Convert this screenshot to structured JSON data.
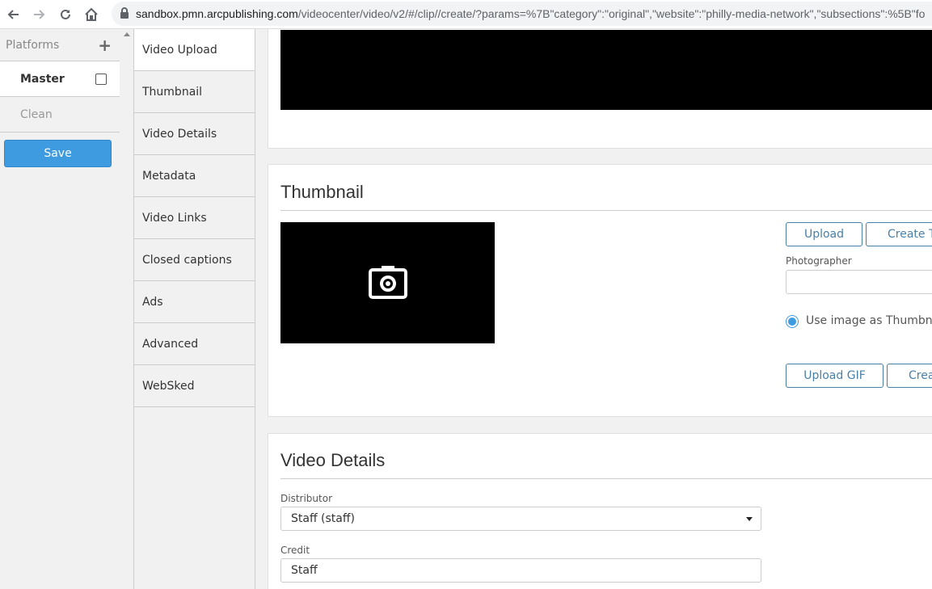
{
  "browser": {
    "url_host": "sandbox.pmn.arcpublishing.com",
    "url_path": "/videocenter/video/v2/#/clip//create/?params=%7B\"category\":\"original\",\"website\":\"philly-media-network\",\"subsections\":%5B\"fo"
  },
  "platforms": {
    "title": "Platforms",
    "items": [
      {
        "label": "Master"
      },
      {
        "label": "Clean"
      }
    ],
    "save_label": "Save"
  },
  "section_nav": {
    "items": [
      {
        "label": "Video Upload"
      },
      {
        "label": "Thumbnail"
      },
      {
        "label": "Video Details"
      },
      {
        "label": "Metadata"
      },
      {
        "label": "Video Links"
      },
      {
        "label": "Closed captions"
      },
      {
        "label": "Ads"
      },
      {
        "label": "Advanced"
      },
      {
        "label": "WebSked"
      }
    ]
  },
  "thumbnail": {
    "title": "Thumbnail",
    "upload_label": "Upload",
    "create_label": "Create Th",
    "photographer_label": "Photographer",
    "photographer_value": "",
    "use_image_label": "Use image as Thumbnail",
    "upload_gif_label": "Upload GIF",
    "create_gif_label": "Creat"
  },
  "video_details": {
    "title": "Video Details",
    "distributor_label": "Distributor",
    "distributor_value": "Staff (staff)",
    "credit_label": "Credit",
    "credit_value": "Staff"
  },
  "colors": {
    "accent": "#3e9be0",
    "outline_button": "#4a7fa6"
  }
}
